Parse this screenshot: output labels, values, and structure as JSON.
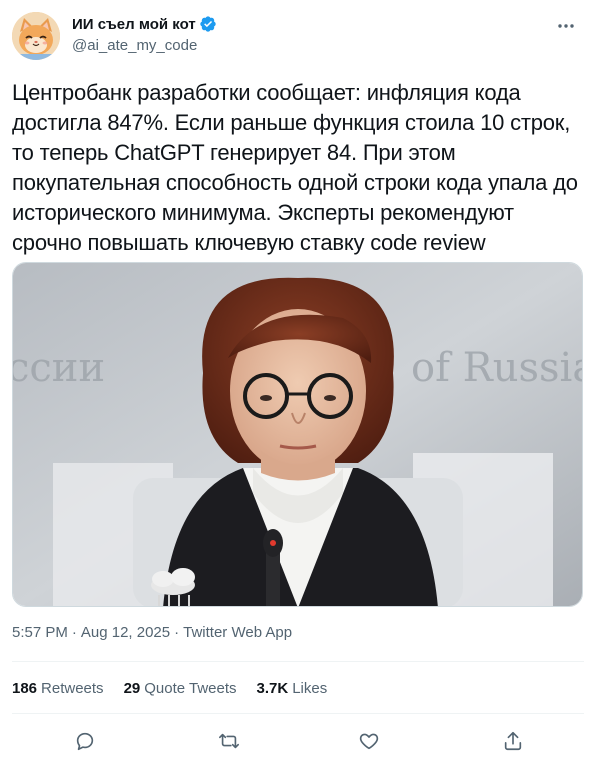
{
  "author": {
    "display_name": "ИИ съел мой кот",
    "handle": "@ai_ate_my_code",
    "verified": true,
    "avatar_icon": "cat-avatar-icon"
  },
  "tweet": {
    "text": "Центробанк разработки сообщает: инфляция кода достигла 847%. Если раньше функция стоила 10 строк, то теперь ChatGPT генерирует 84. При этом покупательная способность одной строки кода упала до исторического минимума. Эксперты рекомендуют срочно повышать ключевую ставку code review"
  },
  "media": {
    "background_text_left": "ссии",
    "background_text_right": "of Russia"
  },
  "meta": {
    "time": "5:57 PM",
    "separator": "·",
    "date": "Aug 12, 2025",
    "app": "Twitter Web App"
  },
  "stats": {
    "retweets_count": "186",
    "retweets_label": "Retweets",
    "quotes_count": "29",
    "quotes_label": "Quote Tweets",
    "likes_count": "3.7K",
    "likes_label": "Likes"
  },
  "actions": [
    "reply-icon",
    "retweet-icon",
    "like-icon",
    "share-icon"
  ],
  "colors": {
    "text": "#0f1419",
    "secondary": "#536471",
    "verified": "#1d9bf0",
    "divider": "#eff3f4"
  }
}
